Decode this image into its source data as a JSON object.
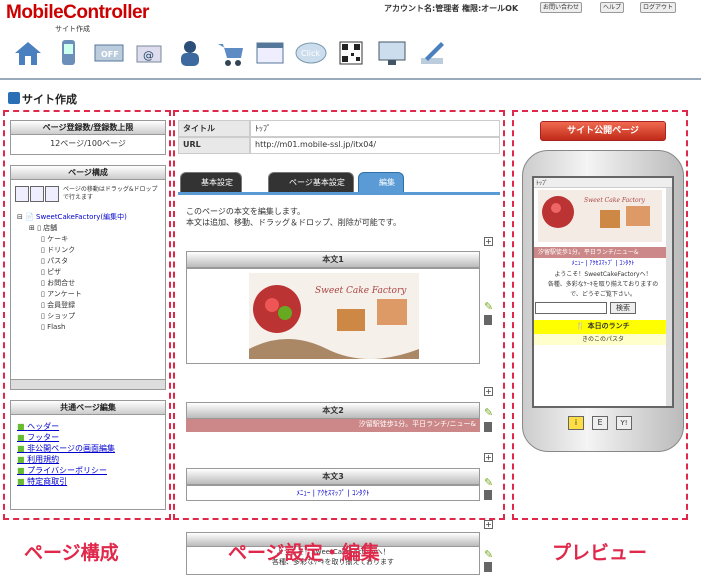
{
  "header": {
    "logo": "MobileController",
    "logo_sub": "サイト作成",
    "account": "アカウント名:管理者 権限:オールOK",
    "contact": "お問い合わせ",
    "help": "ヘルプ",
    "logout": "ログアウト"
  },
  "toolbar": {
    "icons": [
      "home-icon",
      "mobile-icon",
      "off-icon",
      "mail-icon",
      "users-icon",
      "cart-icon",
      "window-icon",
      "click-icon",
      "qr-code-icon",
      "monitor-icon",
      "pen-icon"
    ],
    "click_label": "Click",
    "off_label": "OFF"
  },
  "page_title": "サイト作成",
  "left": {
    "reg_head": "ページ登録数/登録数上限",
    "reg_value": "12ページ/100ページ",
    "struct_head": "ページ構成",
    "struct_note": "ページの移動はドラッグ&ドロップで行えます",
    "tree_root": "SweetCakeFactory(編集中)",
    "tree_items": [
      "店舗",
      "ケーキ",
      "ドリンク",
      "パスタ",
      "ピザ",
      "お問合せ",
      "アンケート",
      "会員登録",
      "ショップ",
      "Flash"
    ],
    "common_head": "共通ページ編集",
    "common_links": [
      "ヘッダー",
      "フッター",
      "非公開ページの画面編集",
      "利用規約",
      "プライバシーポリシー",
      "特定商取引"
    ]
  },
  "center": {
    "title_label": "タイトル",
    "title_value": "ﾄｯﾌﾟ",
    "url_label": "URL",
    "url_value": "http://m01.mobile-ssl.jp/itx04/",
    "tabs": [
      "基本設定",
      "ページ基本設定",
      "編集"
    ],
    "intro1": "このページの本文を編集します。",
    "intro2": "本文は追加、移動、ドラッグ＆ドロップ、削除が可能です。",
    "block1": "本文1",
    "block2": "本文2",
    "block3": "本文3",
    "ticker": "汐留駅徒歩1分。平日ランチ/ニュー&",
    "nav_links": "ﾒﾆｭｰ | ｱｸｾｽﾏｯﾌﾟ | ｺﾝﾀｸﾄ",
    "cut_text1": "ようこそ！SweetCakeFactoryへ！",
    "cut_text2": "各種、多彩なｹｰｷを取り揃えております"
  },
  "right": {
    "publish": "サイト公開ページ",
    "phone_top": "ﾄｯﾌﾟ",
    "ticker": "汐留駅徒歩1分。平日ランチ/ニュー&",
    "nav": "ﾒﾆｭｰ | ｱｸｾｽﾏｯﾌﾟ | ｺﾝﾀｸﾄ",
    "welcome": "ようこそ！SweetCakeFactoryへ！",
    "line2": "各種、多彩なｹｰｷを取り揃えておりますの",
    "line3": "で、どうぞご覧下さい。",
    "search": "検索",
    "lunch": "本日のランチ",
    "lunch_item": "きのこのパスタ",
    "phone_btns": [
      "i",
      "E",
      "Y!"
    ]
  },
  "banner_text": "Sweet Cake Factory",
  "captions": {
    "left": "ページ構成",
    "center": "ページ設定・編集",
    "right": "プレビュー"
  },
  "colors": {
    "accent_red": "#e0284a",
    "tab_blue": "#5b9bd5",
    "link": "#0000cc"
  }
}
